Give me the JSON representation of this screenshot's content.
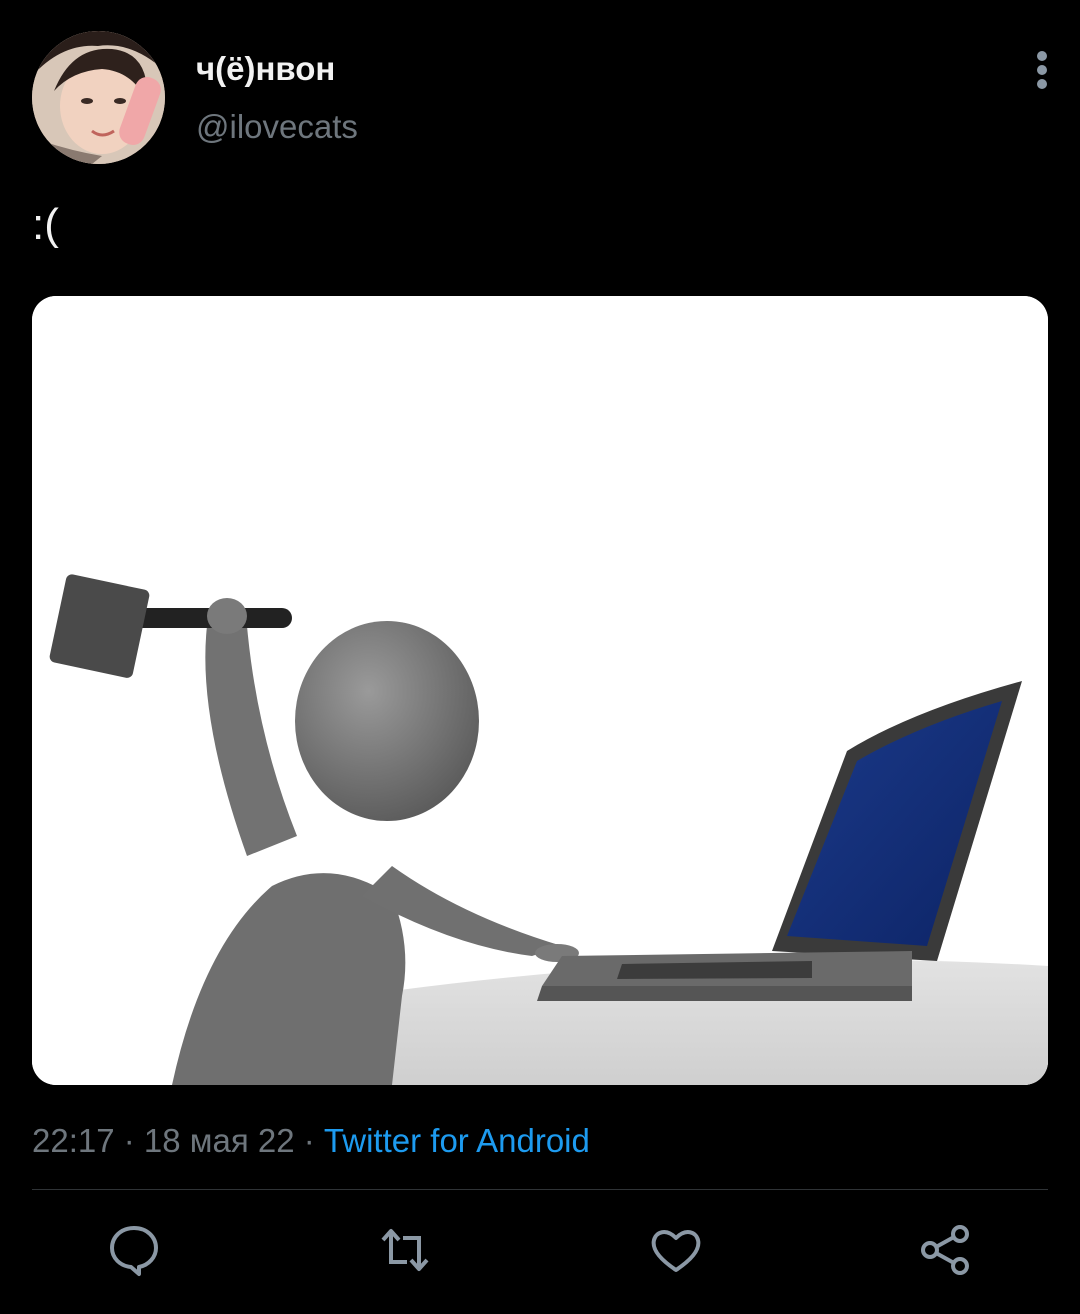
{
  "author": {
    "display_name": "ч(ё)нвон",
    "handle": "@ilovecats",
    "avatar_icon": "avatar-photo"
  },
  "tweet": {
    "text": ":(",
    "image_icon": "figure-smashing-laptop-illustration"
  },
  "meta": {
    "time": "22:17",
    "separator1": " · ",
    "date": "18 мая 22",
    "separator2": " · ",
    "source": "Twitter for Android"
  },
  "actions": [
    {
      "icon": "reply-icon"
    },
    {
      "icon": "retweet-icon"
    },
    {
      "icon": "like-icon"
    },
    {
      "icon": "share-icon"
    }
  ],
  "colors": {
    "background": "#000000",
    "link": "#1d9bf0",
    "muted": "#6e767d",
    "text": "#e7e9ea"
  }
}
